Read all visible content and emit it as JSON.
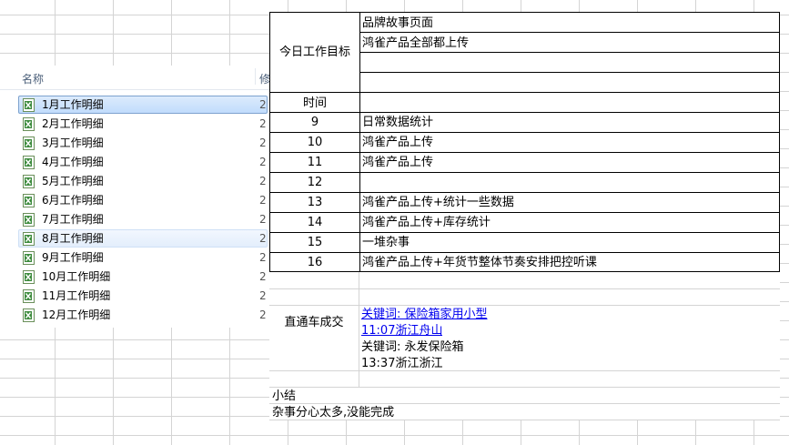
{
  "explorer": {
    "column_name": "名称",
    "column_next": "修",
    "files": [
      {
        "label": "1月工作明细",
        "meta": "2",
        "state": "selected"
      },
      {
        "label": "2月工作明细",
        "meta": "2",
        "state": ""
      },
      {
        "label": "3月工作明细",
        "meta": "2",
        "state": ""
      },
      {
        "label": "4月工作明细",
        "meta": "2",
        "state": ""
      },
      {
        "label": "5月工作明细",
        "meta": "2",
        "state": ""
      },
      {
        "label": "6月工作明细",
        "meta": "2",
        "state": ""
      },
      {
        "label": "7月工作明细",
        "meta": "2",
        "state": ""
      },
      {
        "label": "8月工作明细",
        "meta": "2",
        "state": "hover"
      },
      {
        "label": "9月工作明细",
        "meta": "2",
        "state": ""
      },
      {
        "label": "10月工作明细",
        "meta": "2",
        "state": ""
      },
      {
        "label": "11月工作明细",
        "meta": "2",
        "state": ""
      },
      {
        "label": "12月工作明细",
        "meta": "2",
        "state": ""
      }
    ],
    "icon": "excel-file-icon",
    "selected_color": "#c1dcfc"
  },
  "sheet": {
    "goal_label": "今日工作目标",
    "goals": [
      "品牌故事页面",
      "鸿雀产品全部都上传",
      "",
      ""
    ],
    "time_header": "时间",
    "schedule": [
      {
        "time": "9",
        "task": "日常数据统计"
      },
      {
        "time": "10",
        "task": "鸿雀产品上传"
      },
      {
        "time": "11",
        "task": "鸿雀产品上传"
      },
      {
        "time": "12",
        "task": ""
      },
      {
        "time": "13",
        "task": "鸿雀产品上传+统计一些数据"
      },
      {
        "time": "14",
        "task": "鸿雀产品上传+库存统计"
      },
      {
        "time": "15",
        "task": "一堆杂事"
      },
      {
        "time": "16",
        "task": "鸿雀产品上传+年货节整体节奏安排把控听课"
      }
    ],
    "deal_label": "直通车成交",
    "deal_link_keyword": "关键词: 保险箱家用小型",
    "deal_link_time": "11:07浙江舟山",
    "deal_keyword_2": "关键词: 永发保险箱",
    "deal_time_2": "13:37浙江浙江",
    "summary_label": "小结",
    "summary_text": "杂事分心太多,没能完成"
  }
}
